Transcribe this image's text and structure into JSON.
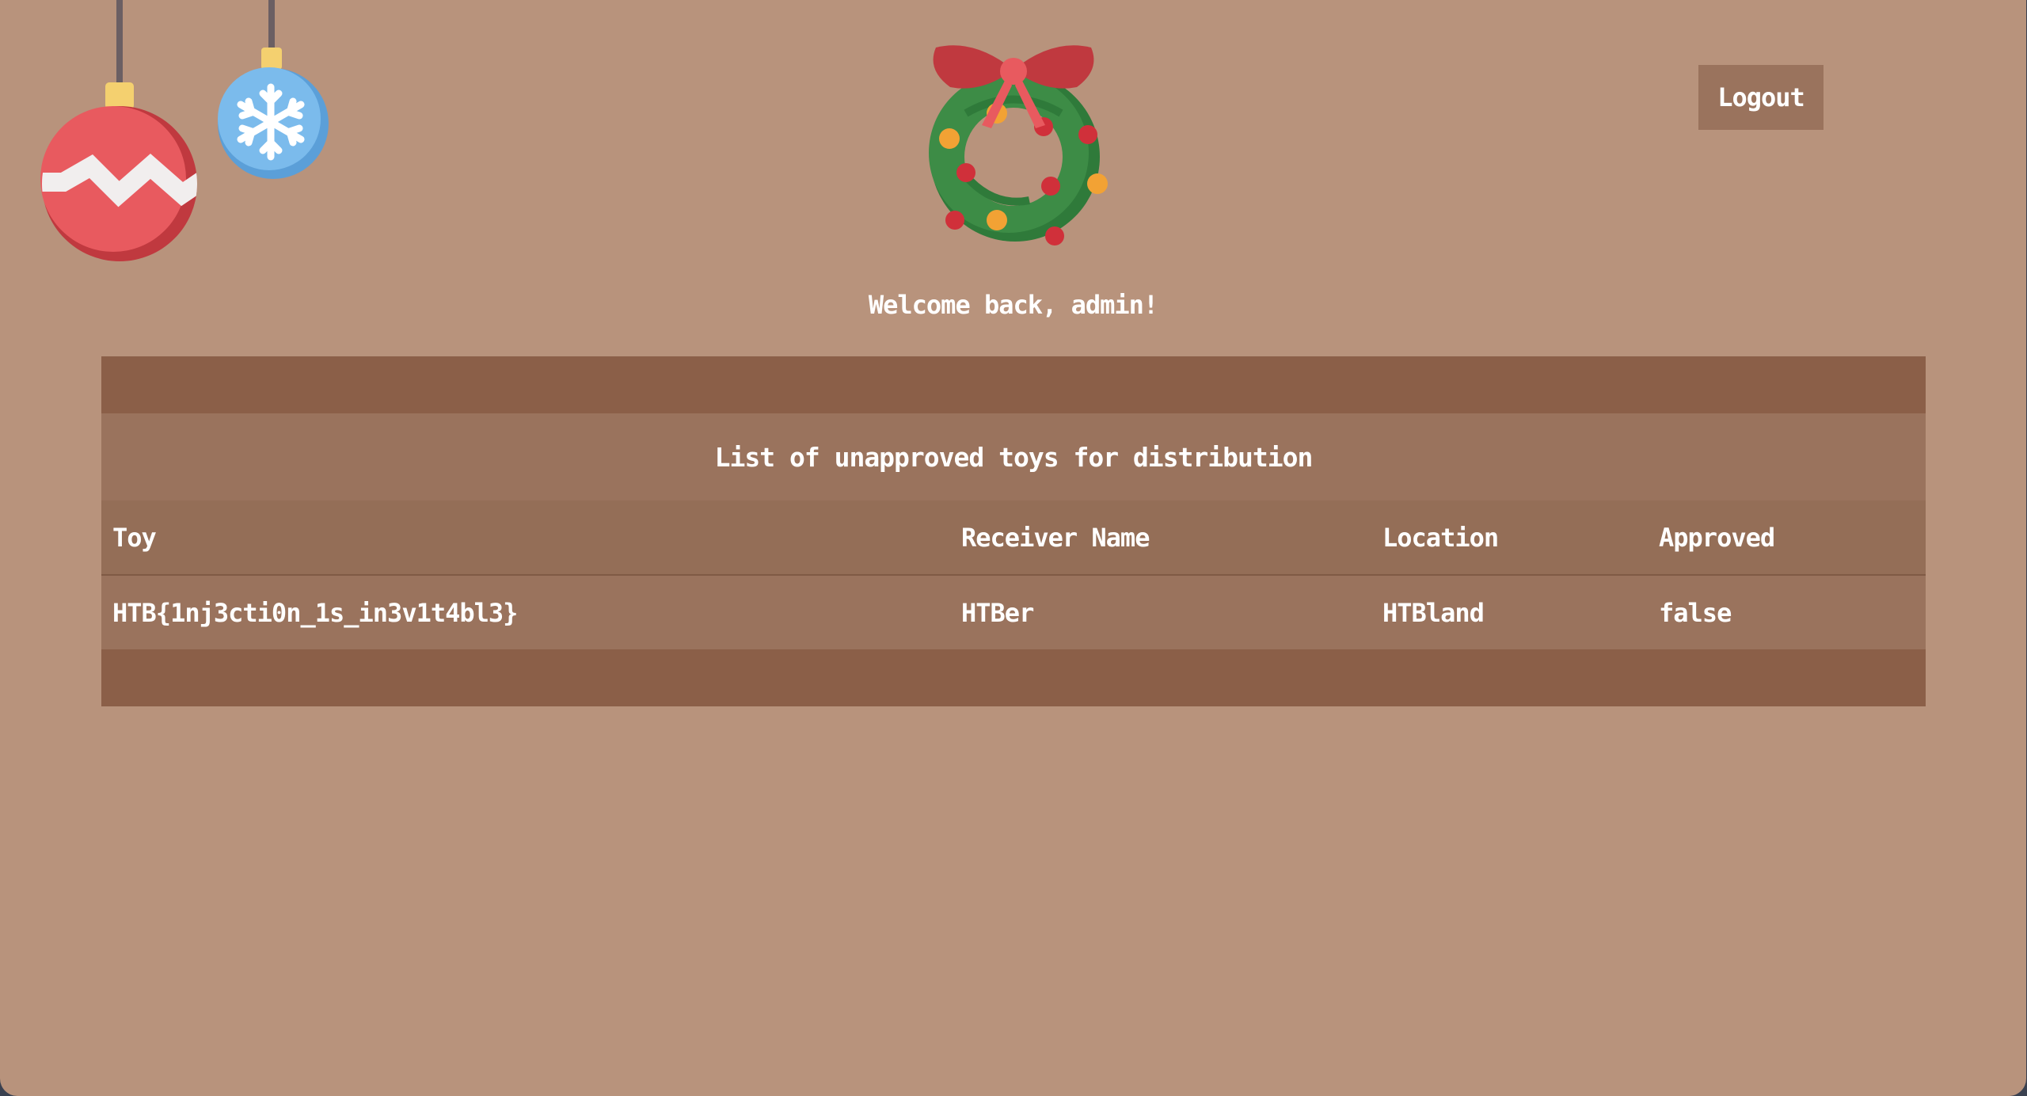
{
  "header": {
    "logout_label": "Logout",
    "welcome_text": "Welcome back, admin!"
  },
  "table": {
    "caption": "List of unapproved toys for distribution",
    "columns": [
      "Toy",
      "Receiver Name",
      "Location",
      "Approved"
    ],
    "rows": [
      [
        "HTB{1nj3cti0n_1s_in3v1t4bl3}",
        "HTBer",
        "HTBland",
        "false"
      ]
    ]
  },
  "decorations": {
    "icons": [
      "red-ornament-icon",
      "blue-snowflake-ornament-icon",
      "christmas-wreath-icon"
    ]
  },
  "colors": {
    "page_background": "#b8937c",
    "table_band": "#8b5f48",
    "table_row": "#9a735d",
    "button": "#9a735d"
  }
}
